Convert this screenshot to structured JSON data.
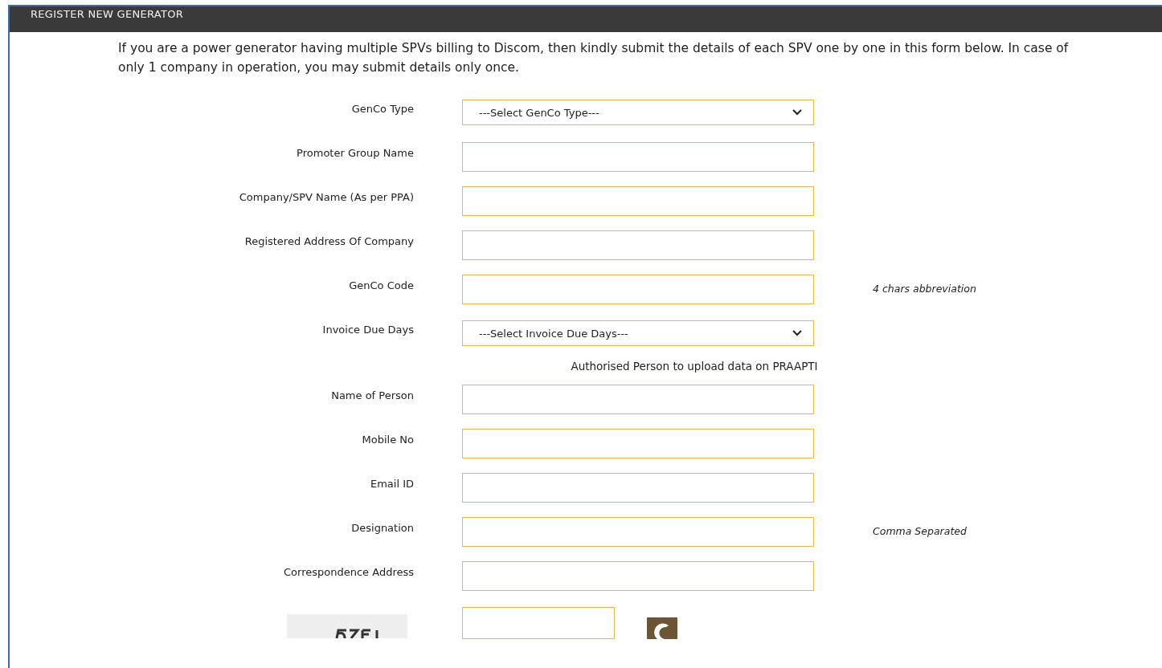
{
  "panel": {
    "title": "REGISTER NEW GENERATOR"
  },
  "intro": "If you are a power generator having multiple SPVs billing to Discom, then kindly submit the details of each SPV one by one in this form below. In case of only 1 company in operation, you may submit details only once.",
  "rows": [
    {
      "kind": "select",
      "label": "GenCo Type",
      "value": "---Select GenCo Type---"
    },
    {
      "kind": "text",
      "label": "Promoter Group Name"
    },
    {
      "kind": "text",
      "label": "Company/SPV Name (As per PPA)"
    },
    {
      "kind": "text",
      "label": "Registered Address Of Company"
    },
    {
      "kind": "text",
      "label": "GenCo Code",
      "note": "4 chars abbreviation"
    },
    {
      "kind": "select",
      "label": "Invoice Due Days",
      "value": "---Select Invoice Due Days---"
    },
    {
      "kind": "heading",
      "label": "Authorised Person to upload data on PRAAPTI"
    },
    {
      "kind": "text",
      "label": "Name of Person"
    },
    {
      "kind": "text",
      "label": "Mobile No"
    },
    {
      "kind": "text",
      "label": "Email ID"
    },
    {
      "kind": "text",
      "label": "Designation",
      "note": "Comma Separated"
    },
    {
      "kind": "text",
      "label": "Correspondence Address"
    },
    {
      "kind": "captcha"
    }
  ]
}
